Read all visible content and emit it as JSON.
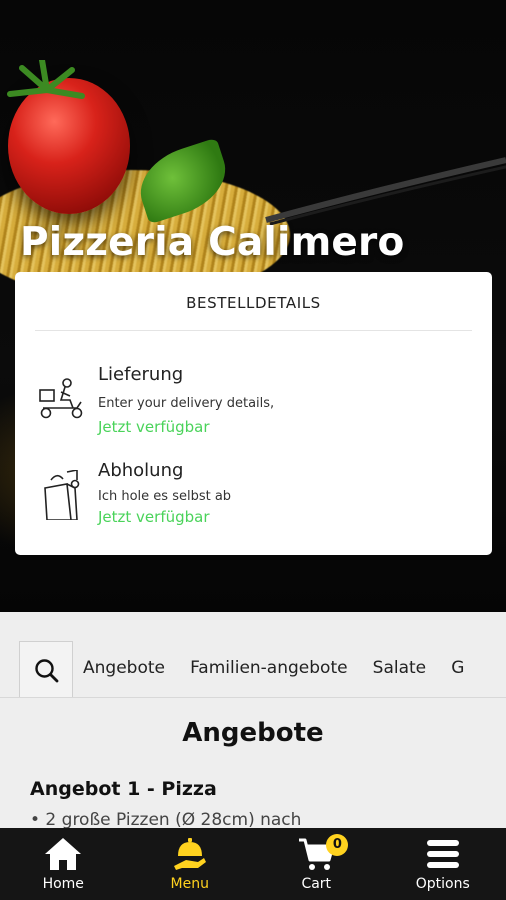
{
  "hero": {
    "shop_name": "Pizzeria Calimero"
  },
  "order_card": {
    "heading": "BESTELLDETAILS",
    "options": [
      {
        "title": "Lieferung",
        "description": "Enter your delivery details,",
        "status": "Jetzt verfügbar",
        "icon": "scooter-delivery-icon"
      },
      {
        "title": "Abholung",
        "description": "Ich hole es selbst ab",
        "status": "Jetzt verfügbar",
        "icon": "takeaway-bag-icon"
      }
    ],
    "status_color": "#4ad35a"
  },
  "categories": {
    "search_icon": "search-icon",
    "items": [
      "Angebote",
      "Familien-angebote",
      "Salate",
      "G"
    ]
  },
  "menu_section": {
    "title": "Angebote",
    "item": {
      "title": "Angebot 1 - Pizza",
      "description": "• 2 große Pizzen (Ø 28cm) nach"
    }
  },
  "bottom_nav": {
    "items": [
      {
        "label": "Home",
        "icon": "home-icon"
      },
      {
        "label": "Menu",
        "icon": "menu-serving-icon",
        "active": true
      },
      {
        "label": "Cart",
        "icon": "cart-icon",
        "badge": "0"
      },
      {
        "label": "Options",
        "icon": "hamburger-menu-icon"
      }
    ],
    "active_color": "#ffd21f"
  }
}
